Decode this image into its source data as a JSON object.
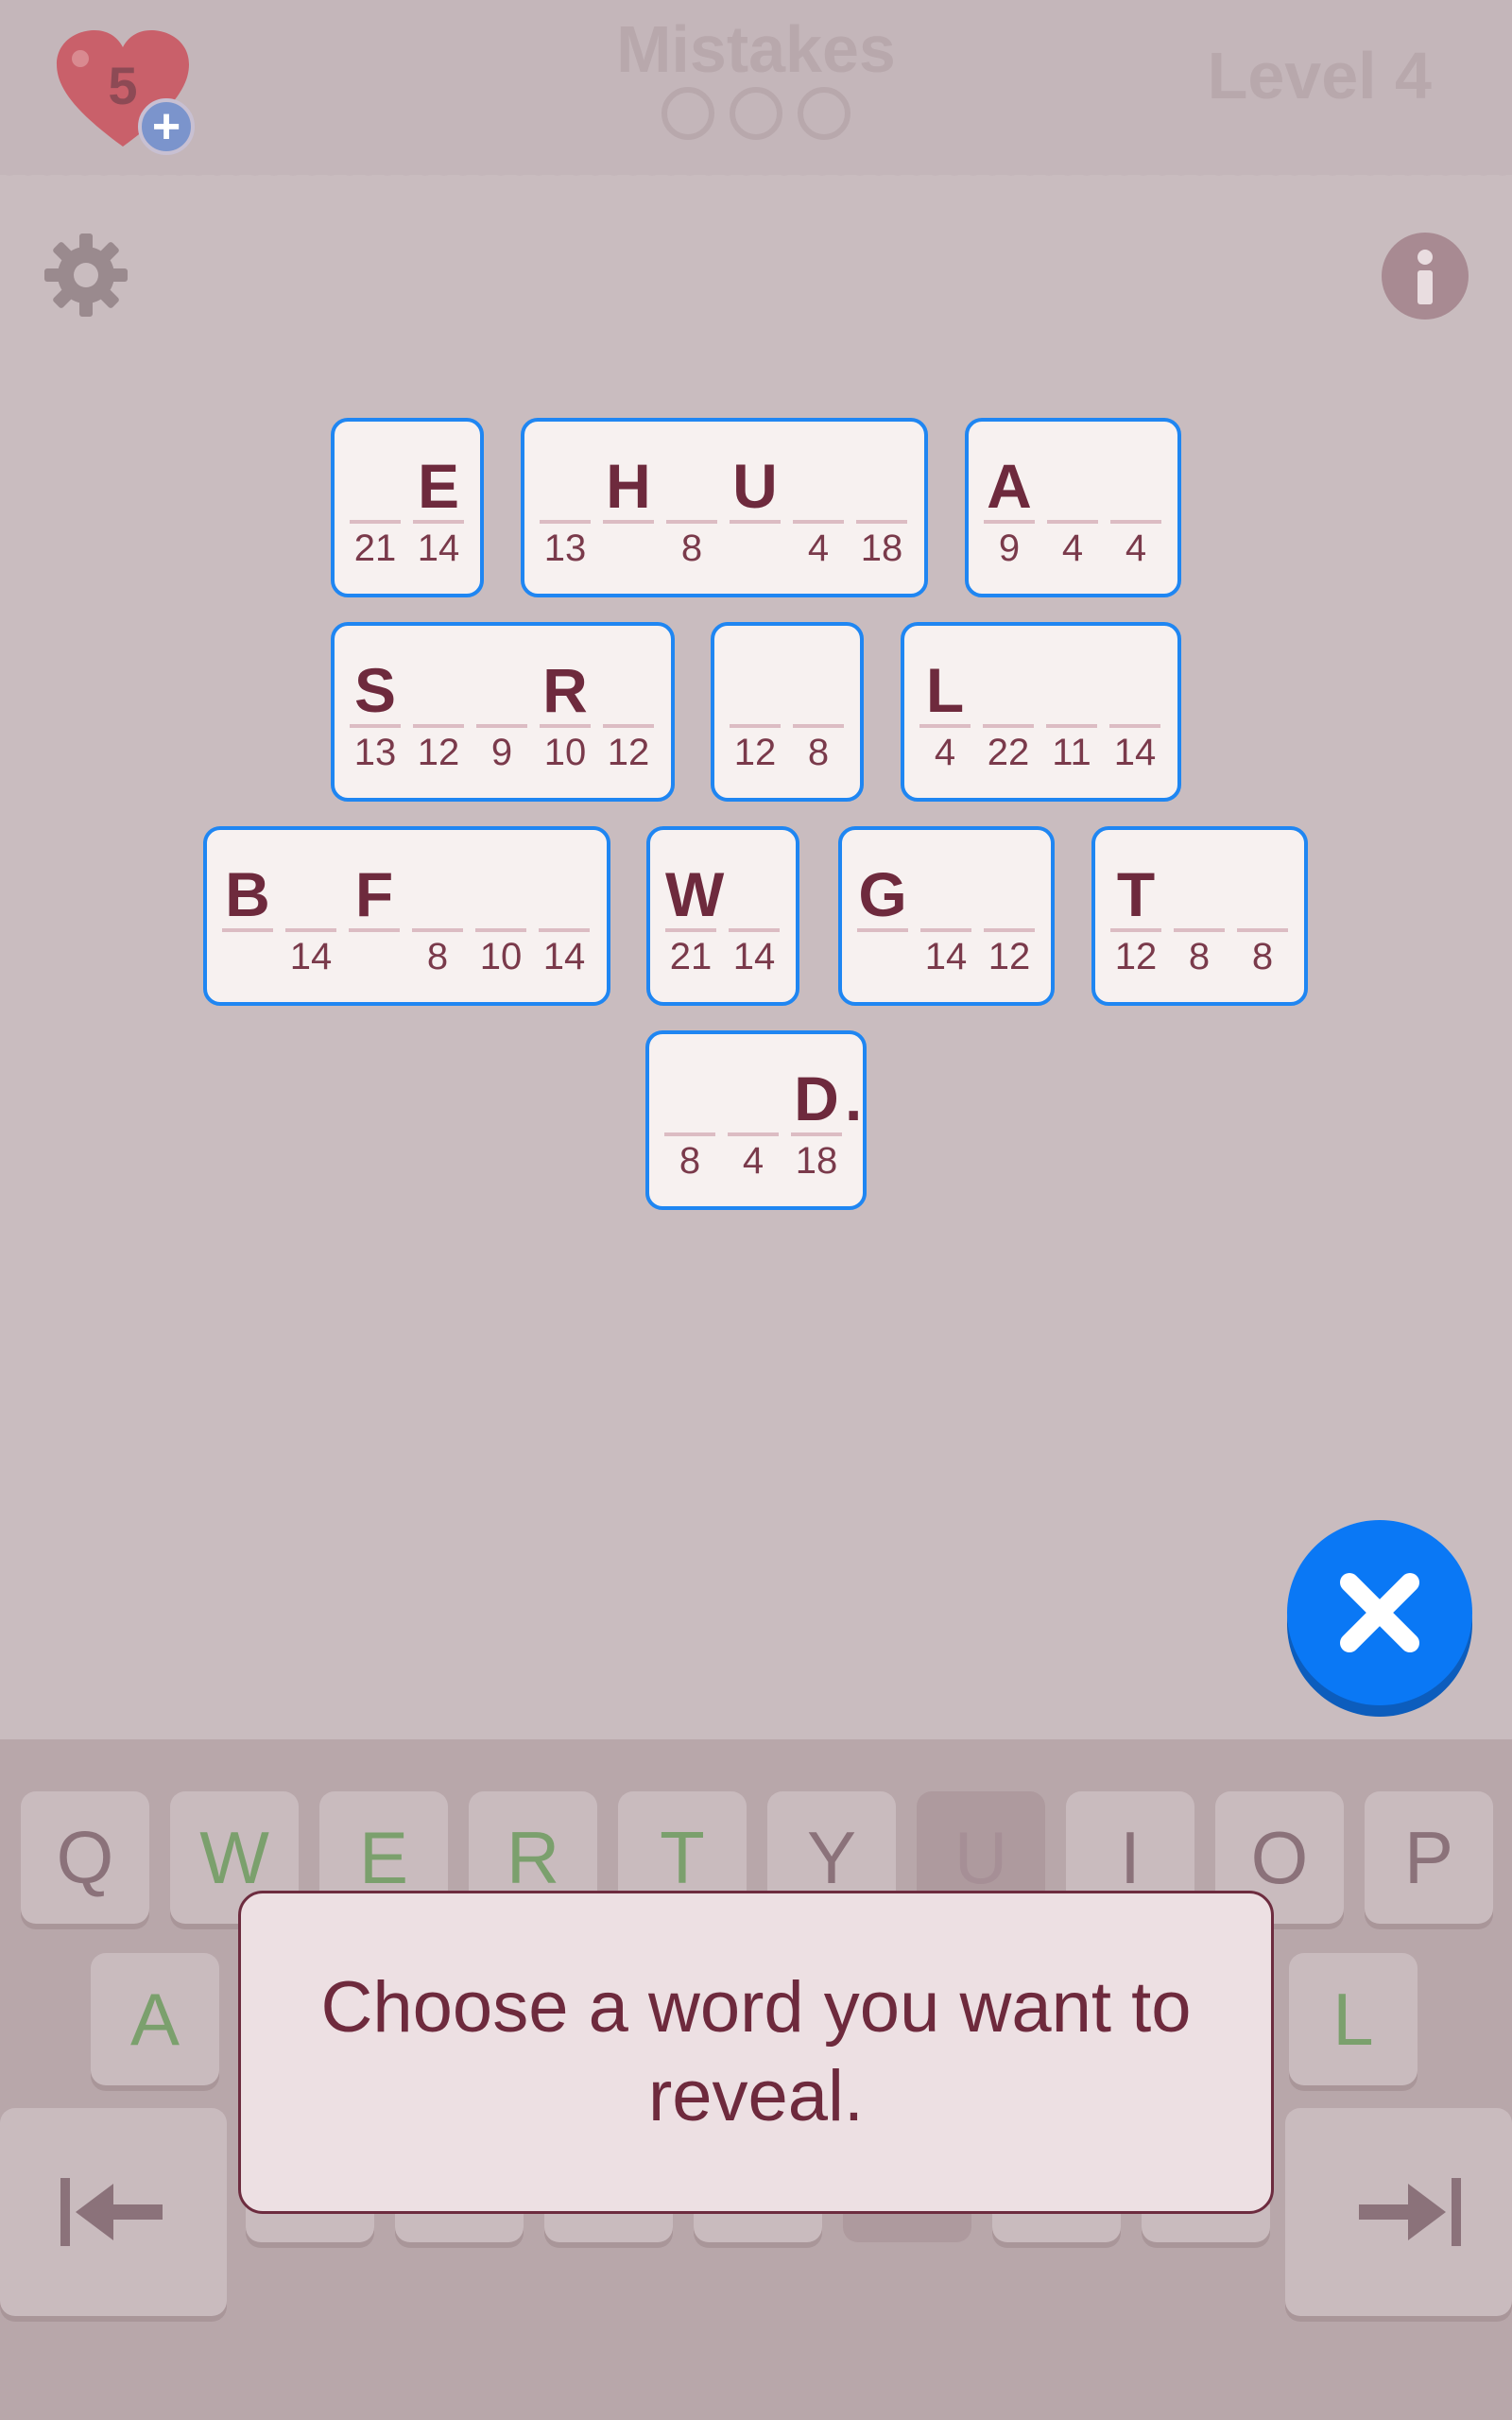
{
  "header": {
    "lives": "5",
    "lives_plus": "+",
    "mistakes_label": "Mistakes",
    "mistakes_made": 0,
    "mistakes_max": 3,
    "level_label": "Level 4"
  },
  "colors": {
    "tile_border": "#1f86f2",
    "letter": "#6e2a3d",
    "close_button": "#0a78f5",
    "correct_key": "#7ba06d"
  },
  "icons": {
    "settings": "gear-icon",
    "info": "info-icon",
    "close": "close-icon",
    "prev": "arrow-left-bar-icon",
    "next": "arrow-right-bar-icon",
    "lives": "heart-icon"
  },
  "puzzle": {
    "words": [
      {
        "cells": [
          {
            "letter": "",
            "num": "21"
          },
          {
            "letter": "E",
            "num": "14"
          }
        ]
      },
      {
        "cells": [
          {
            "letter": "",
            "num": "13"
          },
          {
            "letter": "H",
            "num": ""
          },
          {
            "letter": "",
            "num": "8"
          },
          {
            "letter": "U",
            "num": ""
          },
          {
            "letter": "",
            "num": "4"
          },
          {
            "letter": "",
            "num": "18"
          }
        ]
      },
      {
        "cells": [
          {
            "letter": "A",
            "num": "9"
          },
          {
            "letter": "",
            "num": "4"
          },
          {
            "letter": "",
            "num": "4"
          }
        ]
      },
      {
        "cells": [
          {
            "letter": "S",
            "num": "13"
          },
          {
            "letter": "",
            "num": "12"
          },
          {
            "letter": "",
            "num": "9"
          },
          {
            "letter": "R",
            "num": "10"
          },
          {
            "letter": "",
            "num": "12"
          }
        ]
      },
      {
        "cells": [
          {
            "letter": "",
            "num": "12"
          },
          {
            "letter": "",
            "num": "8"
          }
        ]
      },
      {
        "cells": [
          {
            "letter": "L",
            "num": "4"
          },
          {
            "letter": "",
            "num": "22"
          },
          {
            "letter": "",
            "num": "11"
          },
          {
            "letter": "",
            "num": "14"
          }
        ]
      },
      {
        "cells": [
          {
            "letter": "B",
            "num": ""
          },
          {
            "letter": "",
            "num": "14"
          },
          {
            "letter": "F",
            "num": ""
          },
          {
            "letter": "",
            "num": "8"
          },
          {
            "letter": "",
            "num": "10"
          },
          {
            "letter": "",
            "num": "14"
          }
        ]
      },
      {
        "cells": [
          {
            "letter": "W",
            "num": "21"
          },
          {
            "letter": "",
            "num": "14"
          }
        ]
      },
      {
        "cells": [
          {
            "letter": "G",
            "num": ""
          },
          {
            "letter": "",
            "num": "14"
          },
          {
            "letter": "",
            "num": "12"
          }
        ]
      },
      {
        "cells": [
          {
            "letter": "T",
            "num": "12"
          },
          {
            "letter": "",
            "num": "8"
          },
          {
            "letter": "",
            "num": "8"
          }
        ]
      },
      {
        "cells": [
          {
            "letter": "",
            "num": "8"
          },
          {
            "letter": "",
            "num": "4"
          },
          {
            "letter": "D",
            "num": "18"
          }
        ],
        "suffix": "."
      }
    ]
  },
  "keyboard": {
    "row1": [
      {
        "label": "Q",
        "state": "normal"
      },
      {
        "label": "W",
        "state": "correct"
      },
      {
        "label": "E",
        "state": "correct"
      },
      {
        "label": "R",
        "state": "correct"
      },
      {
        "label": "T",
        "state": "correct"
      },
      {
        "label": "Y",
        "state": "normal"
      },
      {
        "label": "U",
        "state": "used"
      },
      {
        "label": "I",
        "state": "normal"
      },
      {
        "label": "O",
        "state": "normal"
      },
      {
        "label": "P",
        "state": "normal"
      }
    ],
    "row2_visible": [
      {
        "label": "A",
        "state": "correct"
      },
      {
        "label": "L",
        "state": "correct"
      }
    ]
  },
  "popup": {
    "text": "Choose a word you want to reveal."
  }
}
